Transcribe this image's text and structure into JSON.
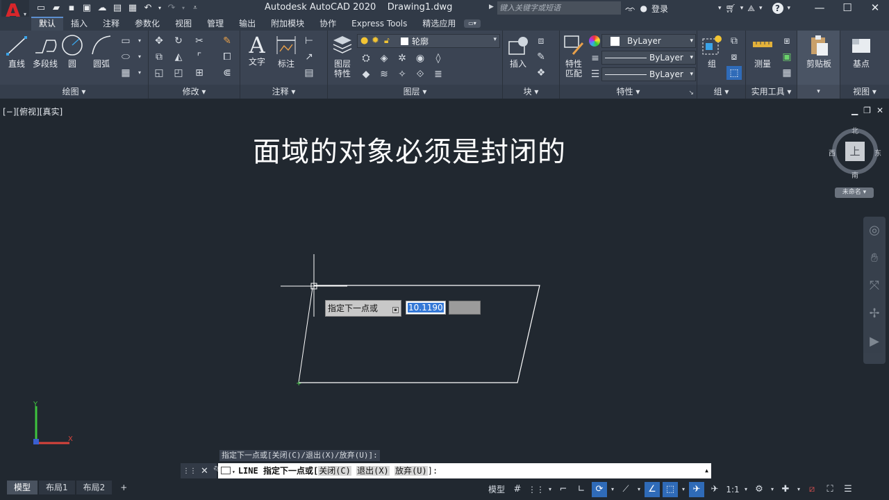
{
  "app": {
    "title": "Autodesk AutoCAD 2020    Drawing1.dwg",
    "search_placeholder": "键入关键字或短语",
    "login": "登录",
    "help": "?"
  },
  "tabs": [
    "默认",
    "插入",
    "注释",
    "参数化",
    "视图",
    "管理",
    "输出",
    "附加模块",
    "协作",
    "Express Tools",
    "精选应用"
  ],
  "ribbon": {
    "draw": {
      "title": "绘图 ▾",
      "line": "直线",
      "polyline": "多段线",
      "circle": "圆",
      "arc": "圆弧"
    },
    "modify": {
      "title": "修改 ▾"
    },
    "annotation": {
      "title": "注释 ▾",
      "text": "文字",
      "dimension": "标注"
    },
    "layers": {
      "title": "图层 ▾",
      "properties_line1": "图层",
      "properties_line2": "特性",
      "current_layer": "轮廓"
    },
    "block": {
      "title": "块 ▾",
      "insert": "插入"
    },
    "properties": {
      "title": "特性 ▾",
      "match_line1": "特性",
      "match_line2": "匹配",
      "color": "ByLayer",
      "linetype": "ByLayer",
      "lineweight": "ByLayer"
    },
    "groups": {
      "title": "组 ▾",
      "group": "组"
    },
    "utilities": {
      "title": "实用工具 ▾",
      "measure": "测量"
    },
    "clipboard": {
      "title": "",
      "paste": "剪贴板"
    },
    "view": {
      "title": "视图 ▾",
      "base": "基点"
    }
  },
  "viewport": {
    "label": "[−][俯视][真实]",
    "overlay_title": "面域的对象必须是封闭的",
    "dynamic_prompt": "指定下一点或",
    "dynamic_value": "10.1190"
  },
  "viewcube": {
    "north": "北",
    "south": "南",
    "east": "东",
    "west": "西",
    "face": "上",
    "wcs": "未命名 ▾"
  },
  "command": {
    "history": "指定下一点或[关闭(C)/退出(X)/放弃(U)]:",
    "prefix": "LINE 指定下一点或[",
    "opt1": "关闭(C)",
    "opt2": "退出(X)",
    "opt3": "放弃(U)",
    "suffix": "]:"
  },
  "status": {
    "layouts": [
      "模型",
      "布局1",
      "布局2"
    ],
    "model": "模型",
    "scale": "1:1"
  }
}
